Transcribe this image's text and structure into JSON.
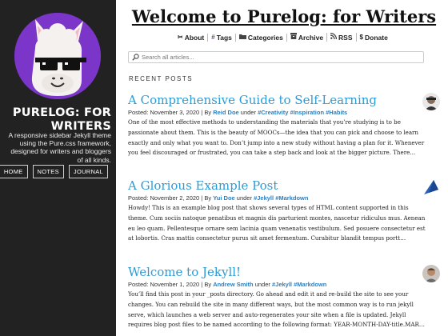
{
  "sidebar": {
    "title": "PURELOG: FOR WRITERS",
    "description": "A responsive sidebar Jekyll theme using the Pure.css framework, designed for writers and bloggers of all kinds.",
    "nav": [
      "HOME",
      "NOTES",
      "JOURNAL"
    ],
    "accent": "#7b35c9"
  },
  "header": {
    "title": "Welcome to Purelog: for Writers",
    "nav": [
      {
        "icon": "scissors-icon",
        "label": "About"
      },
      {
        "icon": "hash-icon",
        "label": "Tags"
      },
      {
        "icon": "folder-icon",
        "label": "Categories"
      },
      {
        "icon": "archive-icon",
        "label": "Archive"
      },
      {
        "icon": "rss-icon",
        "label": "RSS"
      },
      {
        "icon": "dollar-icon",
        "label": "Donate"
      }
    ]
  },
  "search": {
    "placeholder": "Search all articles..."
  },
  "section_label": "RECENT POSTS",
  "posts": [
    {
      "title": "A Comprehensive Guide to Self-Learning",
      "posted": "Posted: November 3, 2020 | By",
      "author": "Reid Doe",
      "under": "under",
      "tags": [
        "#Creativity",
        "#Inspiration",
        "#Habits"
      ],
      "excerpt": "One of the most effective methods to understanding the materials that you’re studying is to be passionate about them. This is the beauty of MOOCs—the idea that you can pick and choose to learn exactly and only what you want to. Don’t jump into a new study without having a plan for it. Whenever you feel discouraged or frustrated, you can take a step back and look at the bigger picture. There…"
    },
    {
      "title": "A Glorious Example Post",
      "posted": "Posted: November 2, 2020 | By",
      "author": "Yui Doe",
      "under": "under",
      "tags": [
        "#Jekyll",
        "#Markdown"
      ],
      "excerpt": "Howdy! This is an example blog post that shows several types of HTML content supported in this theme. Cum sociis natoque penatibus et magnis dis parturient montes, nascetur ridiculus mus. Aenean eu leo quam. Pellentesque ornare sem lacinia quam venenatis vestibulum. Sed posuere consectetur est at lobortis. Cras mattis consectetur purus sit amet fermentum. Curabitur blandit tempus portt…"
    },
    {
      "title": "Welcome to Jekyll!",
      "posted": "Posted: November 1, 2020 | By",
      "author": "Andrew Smith",
      "under": "under",
      "tags": [
        "#Jekyll",
        "#Markdown"
      ],
      "excerpt": "You’ll find this post in your _posts directory. Go ahead and edit it and re-build the site to see your changes. You can rebuild the site in many different ways, but the most common way is to run jekyll serve, which launches a web server and auto-regenerates your site when a file is updated. Jekyll requires blog post files to be named according to the following format: YEAR-MONTH-DAY-title.MAR…"
    }
  ]
}
